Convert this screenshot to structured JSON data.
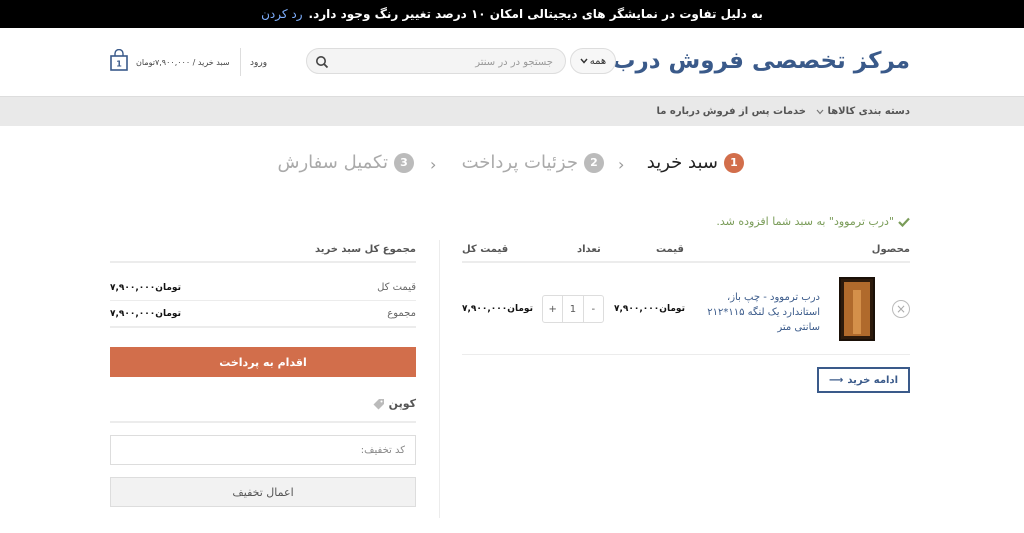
{
  "notice": {
    "text": "به دلیل تفاوت در نمایشگر های دیجیتالی امکان ۱۰ درصد تغییر رنگ وجود دارد.",
    "dismiss": "رد کردن"
  },
  "header": {
    "logo": "مرکز تخصصی فروش درب",
    "search": {
      "category": "همه",
      "placeholder": "جستجو در در سنتر"
    },
    "login": "ورود",
    "cart_summary": "سبد خرید / ۷,۹۰۰,۰۰۰تومان",
    "cart_count": "1"
  },
  "nav": {
    "items": [
      "دسته بندی کالاها",
      "خدمات پس از فروش",
      "درباره ما"
    ]
  },
  "steps": [
    {
      "num": "1",
      "label": "سبد خرید"
    },
    {
      "num": "2",
      "label": "جزئیات پرداخت"
    },
    {
      "num": "3",
      "label": "تکمیل سفارش"
    }
  ],
  "message": "\"درب ترموود\" به سبد شما افزوده شد.",
  "cart": {
    "headers": {
      "product": "محصول",
      "price": "قیمت",
      "quantity": "تعداد",
      "subtotal": "قیمت کل"
    },
    "item": {
      "name": "درب ترموود - چپ باز، استاندارد یک لنگه ۱۱۵*۲۱۲ سانتی متر",
      "price": "۷,۹۰۰,۰۰۰تومان",
      "quantity": "1",
      "subtotal": "۷,۹۰۰,۰۰۰تومان"
    },
    "continue_label": "ادامه خرید"
  },
  "totals": {
    "title": "مجموع کل سبد خرید",
    "rows": [
      {
        "label": "قیمت کل",
        "value": "۷,۹۰۰,۰۰۰تومان"
      },
      {
        "label": "مجموع",
        "value": "۷,۹۰۰,۰۰۰تومان"
      }
    ],
    "checkout_label": "اقدام به پرداخت",
    "coupon_title": "کوپن",
    "coupon_placeholder": "کد تخفیف:",
    "apply_label": "اعمال تخفیف"
  },
  "colors": {
    "accent": "#d26e4b",
    "primary": "#3a5a8a",
    "success": "#7a9c59"
  }
}
